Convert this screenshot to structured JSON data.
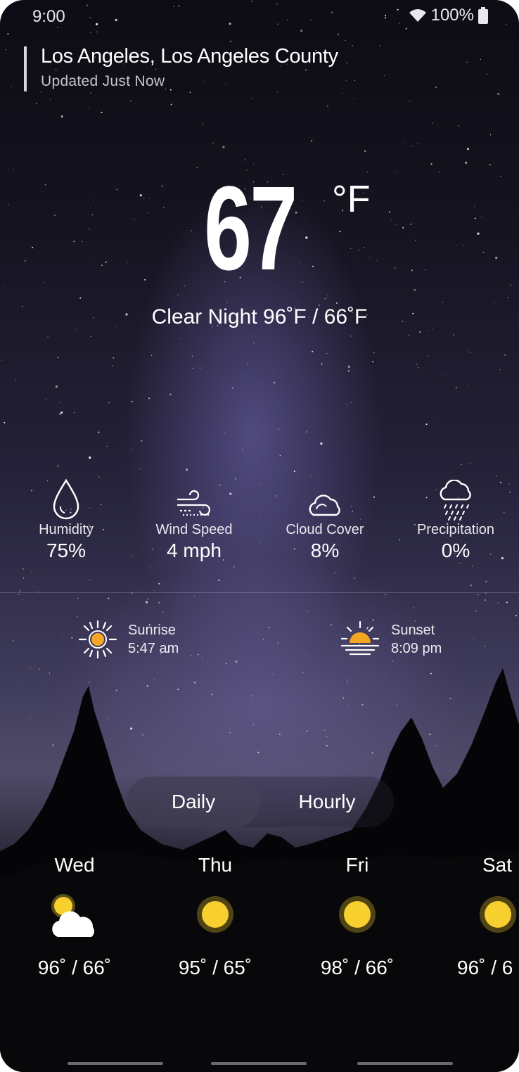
{
  "status_bar": {
    "time": "9:00",
    "battery": "100%",
    "wifi_icon": "wifi-icon",
    "battery_icon": "battery-icon"
  },
  "location": {
    "title": "Los Angeles, Los Angeles County",
    "updated": "Updated Just Now"
  },
  "current": {
    "temperature": "67",
    "unit": "°F",
    "condition": "Clear Night 96˚F / 66˚F"
  },
  "stats": [
    {
      "label": "Humidity",
      "value": "75%",
      "icon": "droplet-icon"
    },
    {
      "label": "Wind Speed",
      "value": "4 mph",
      "icon": "wind-icon"
    },
    {
      "label": "Cloud Cover",
      "value": "8%",
      "icon": "cloud-icon"
    },
    {
      "label": "Precipitation",
      "value": "0%",
      "icon": "rain-cloud-icon"
    }
  ],
  "sun": {
    "sunrise_label": "Sunrise",
    "sunrise_time": "5:47 am",
    "sunset_label": "Sunset",
    "sunset_time": "8:09 pm"
  },
  "tabs": {
    "daily": "Daily",
    "hourly": "Hourly",
    "active": "daily"
  },
  "forecast": [
    {
      "day": "Wed",
      "range": "96˚ / 66˚",
      "icon": "partly-cloudy-icon"
    },
    {
      "day": "Thu",
      "range": "95˚ / 65˚",
      "icon": "sun-icon"
    },
    {
      "day": "Fri",
      "range": "98˚ / 66˚",
      "icon": "sun-icon"
    },
    {
      "day": "Sat",
      "range": "96˚ / 6",
      "icon": "sun-icon"
    }
  ],
  "colors": {
    "sun_yellow": "#f7d030",
    "sun_orange": "#f5a623",
    "text_primary": "#ffffff"
  }
}
